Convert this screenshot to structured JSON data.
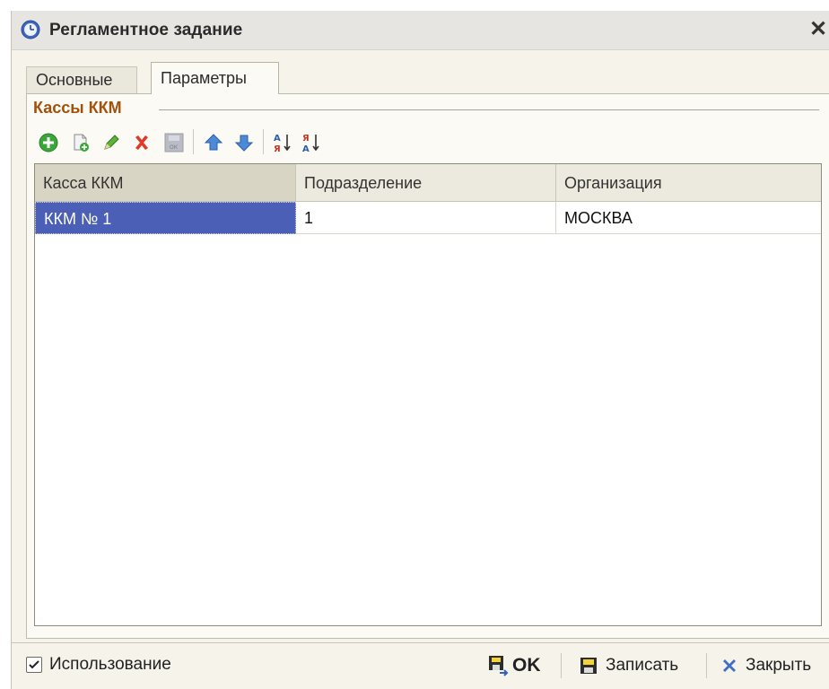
{
  "window": {
    "title": "Регламентное задание",
    "close_label": "✕"
  },
  "tabs": [
    {
      "label": "Основные",
      "active": false
    },
    {
      "label": "Параметры",
      "active": true
    }
  ],
  "group": {
    "title": "Кассы ККМ"
  },
  "toolbar": {
    "icons": [
      "add-icon",
      "copy-icon",
      "edit-icon",
      "delete-icon",
      "save-icon",
      "move-up-icon",
      "move-down-icon",
      "sort-asc-icon",
      "sort-desc-icon"
    ],
    "sort_asc_glyph": "А",
    "sort_desc_glyph": "Я"
  },
  "table": {
    "columns": [
      "Касса ККМ",
      "Подразделение",
      "Организация"
    ],
    "rows": [
      {
        "kassa": "ККМ № 1",
        "podrazdelenie": "1",
        "organizaciya": "МОСКВА",
        "selected": true
      }
    ]
  },
  "footer": {
    "use_label": "Использование",
    "use_checked": true,
    "ok_label": "OK",
    "save_label": "Записать",
    "close_label": "Закрыть"
  },
  "colors": {
    "selection": "#4a5fb5",
    "group_title": "#a0520c",
    "add_green": "#3aa63a",
    "delete_red": "#e0392a",
    "arrow_blue": "#4c8ad8"
  }
}
